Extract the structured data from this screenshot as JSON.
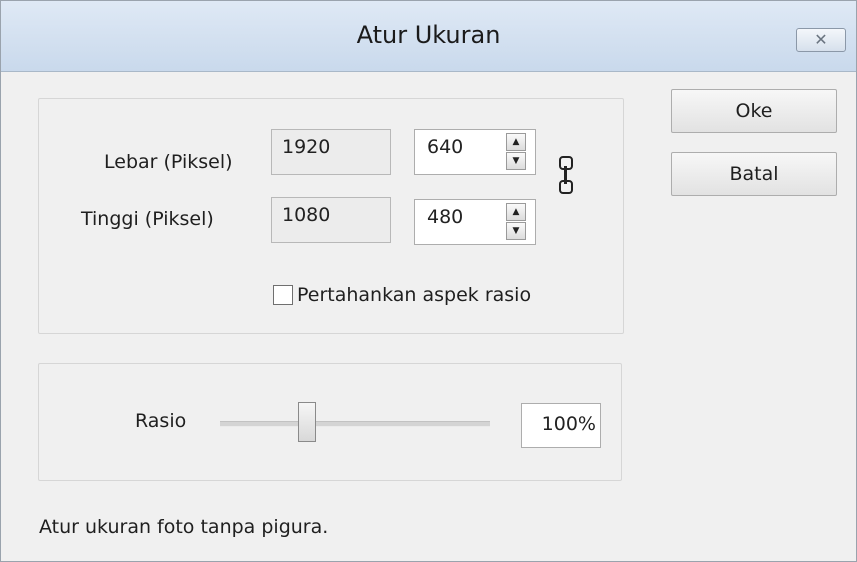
{
  "window": {
    "title": "Atur Ukuran",
    "close_icon": "close-icon"
  },
  "size": {
    "width_label": "Lebar (Piksel)",
    "height_label": "Tinggi (Piksel)",
    "width_original": "1920",
    "height_original": "1080",
    "width_value": "640",
    "height_value": "480",
    "aspect_checkbox_label": "Pertahankan aspek rasio",
    "aspect_checked": false,
    "link_icon": "chain-link-icon"
  },
  "ratio": {
    "label": "Rasio",
    "value": "100%",
    "slider_position_percent": 32
  },
  "buttons": {
    "ok": "Oke",
    "cancel": "Batal"
  },
  "footer": {
    "text": "Atur ukuran foto tanpa pigura."
  }
}
